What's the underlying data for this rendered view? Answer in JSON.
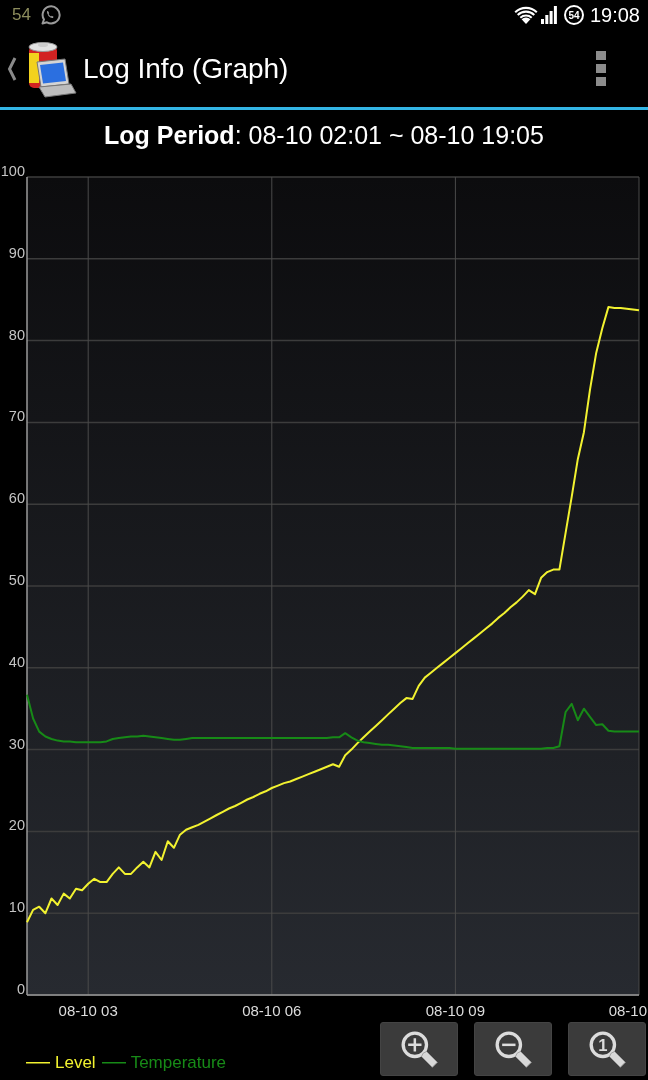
{
  "status_bar": {
    "left_count": "54",
    "ring_indicator": "54",
    "time": "19:08"
  },
  "action_bar": {
    "title": "Log Info (Graph)"
  },
  "header": {
    "text": "**Log Period**: 08-10 02:01 ~ 08-10 19:05"
  },
  "graph": {
    "chart_data": {
      "type": "line",
      "grid": true,
      "legend": "lower left",
      "categories": [
        null,
        null,
        null,
        null,
        null,
        null,
        null,
        null,
        null,
        null,
        "08-10 03",
        null,
        null,
        null,
        null,
        null,
        null,
        null,
        null,
        null,
        null,
        null,
        null,
        null,
        null,
        null,
        null,
        null,
        null,
        null,
        null,
        null,
        null,
        null,
        null,
        null,
        null,
        null,
        null,
        null,
        "08-10 06",
        null,
        null,
        null,
        null,
        null,
        null,
        null,
        null,
        null,
        null,
        null,
        null,
        null,
        null,
        null,
        null,
        null,
        null,
        null,
        null,
        null,
        null,
        null,
        null,
        null,
        null,
        null,
        null,
        null,
        "08-10 09",
        null,
        null,
        null,
        null,
        null,
        null,
        null,
        null,
        null,
        null,
        null,
        null,
        null,
        null,
        null,
        null,
        null,
        null,
        null,
        null,
        null,
        null,
        null,
        null,
        null,
        null,
        null,
        null,
        null,
        "08-10"
      ],
      "ylim": [
        0,
        100
      ],
      "yticks": [
        0,
        10,
        20,
        30,
        40,
        50,
        60,
        70,
        80,
        90,
        100
      ],
      "series": [
        {
          "name": "Level",
          "color": "#f2f230",
          "values": [
            8.9,
            10.4,
            10.8,
            10.0,
            11.8,
            11.0,
            12.4,
            11.8,
            13.0,
            12.8,
            13.6,
            14.2,
            13.8,
            13.8,
            14.8,
            15.6,
            14.8,
            14.8,
            15.6,
            16.3,
            15.6,
            17.5,
            16.5,
            18.8,
            18.0,
            19.6,
            20.2,
            20.5,
            20.8,
            21.2,
            21.6,
            22.0,
            22.4,
            22.8,
            23.1,
            23.5,
            23.9,
            24.2,
            24.6,
            24.9,
            25.3,
            25.6,
            25.9,
            26.1,
            26.4,
            26.7,
            27.0,
            27.3,
            27.6,
            27.9,
            28.2,
            27.9,
            29.3,
            30.0,
            30.8,
            31.5,
            32.2,
            32.9,
            33.6,
            34.3,
            35.0,
            35.7,
            36.3,
            36.2,
            37.8,
            38.8,
            39.4,
            40.0,
            40.6,
            41.2,
            41.8,
            42.4,
            43.0,
            43.6,
            44.2,
            44.8,
            45.4,
            46.1,
            46.7,
            47.4,
            48.0,
            48.7,
            49.5,
            49.0,
            51.0,
            51.7,
            52.0,
            52.0,
            56.5,
            60.9,
            65.5,
            68.8,
            74.0,
            78.5,
            81.5,
            84.1,
            84.0,
            84.0,
            83.9,
            83.8,
            83.7
          ]
        },
        {
          "name": "Temperature",
          "color": "#178a17",
          "values": [
            36.7,
            33.8,
            32.2,
            31.6,
            31.3,
            31.1,
            31.0,
            31.0,
            30.9,
            30.9,
            30.9,
            30.9,
            30.9,
            31.0,
            31.3,
            31.4,
            31.5,
            31.6,
            31.6,
            31.7,
            31.6,
            31.5,
            31.4,
            31.3,
            31.2,
            31.2,
            31.3,
            31.4,
            31.4,
            31.4,
            31.4,
            31.4,
            31.4,
            31.4,
            31.4,
            31.4,
            31.4,
            31.4,
            31.4,
            31.4,
            31.4,
            31.4,
            31.4,
            31.4,
            31.4,
            31.4,
            31.4,
            31.4,
            31.4,
            31.4,
            31.5,
            31.5,
            32.0,
            31.5,
            31.1,
            30.9,
            30.8,
            30.7,
            30.6,
            30.6,
            30.5,
            30.4,
            30.3,
            30.2,
            30.2,
            30.2,
            30.2,
            30.2,
            30.2,
            30.2,
            30.1,
            30.1,
            30.1,
            30.1,
            30.1,
            30.1,
            30.1,
            30.1,
            30.1,
            30.1,
            30.1,
            30.1,
            30.1,
            30.1,
            30.1,
            30.2,
            30.2,
            30.4,
            34.6,
            35.6,
            33.6,
            35.0,
            34.0,
            33.0,
            33.1,
            32.3,
            32.2,
            32.2,
            32.2,
            32.2,
            32.2
          ]
        }
      ]
    },
    "buttons": [
      {
        "kind": "zoom_in"
      },
      {
        "kind": "zoom_out"
      },
      {
        "kind": "zoom_reset",
        "label": "1"
      }
    ]
  }
}
